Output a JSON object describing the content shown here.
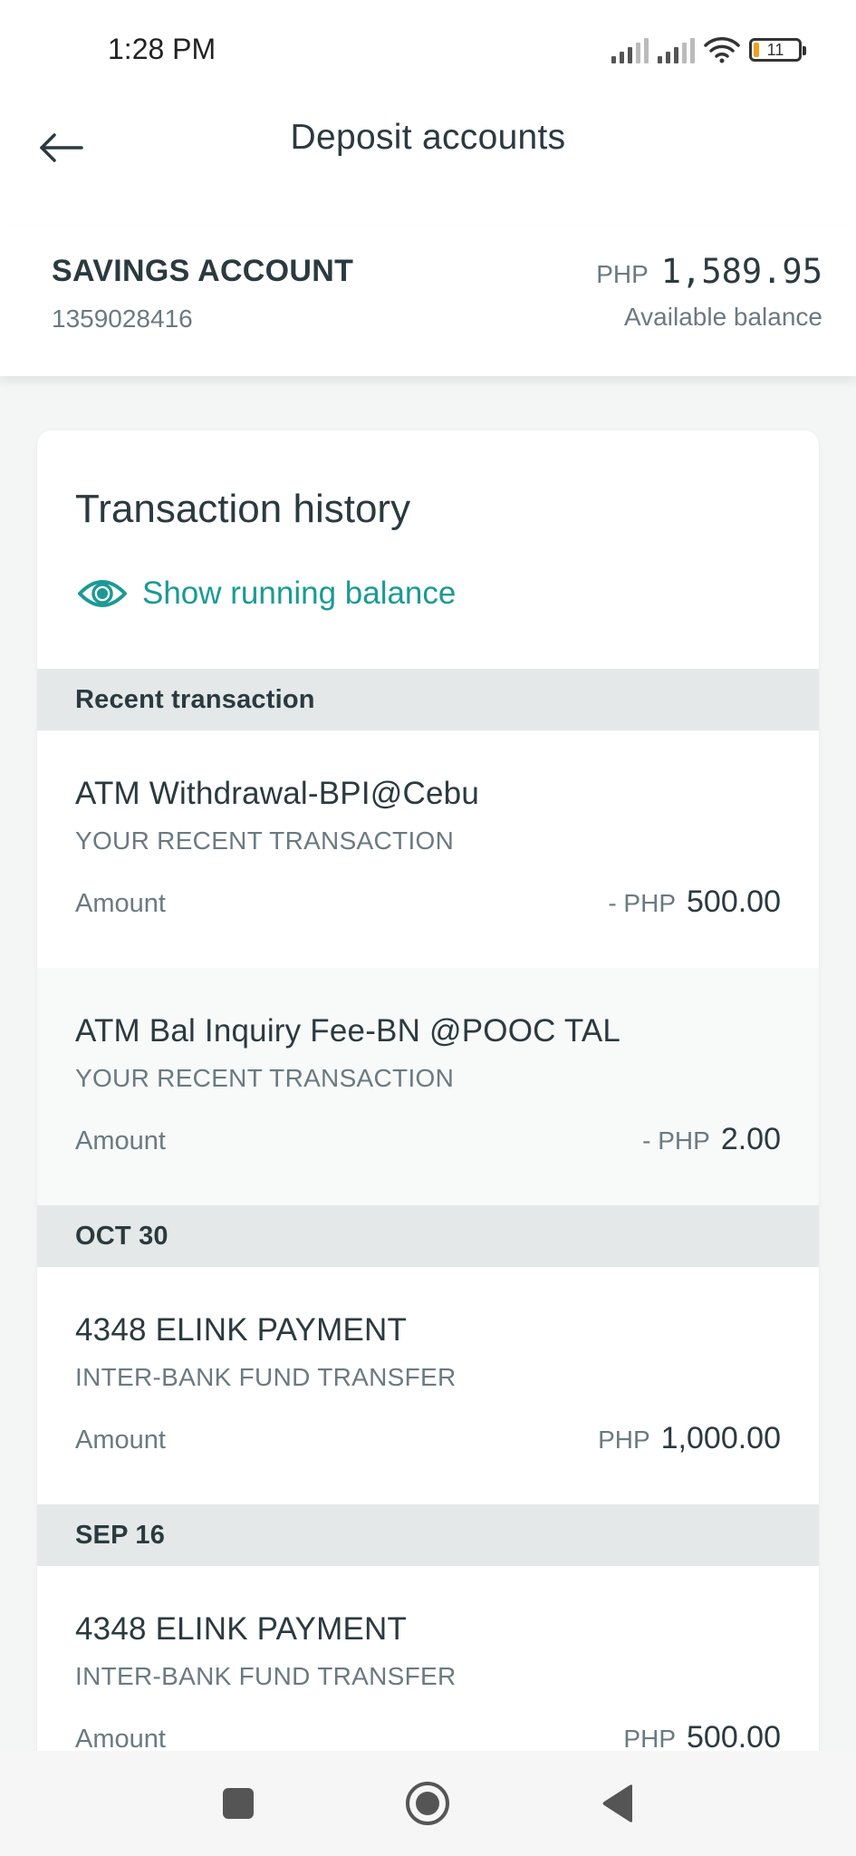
{
  "status": {
    "time": "1:28 PM",
    "battery_level": "11"
  },
  "header": {
    "title": "Deposit accounts",
    "back_icon": "arrow-left-icon"
  },
  "account": {
    "name": "SAVINGS ACCOUNT",
    "number": "1359028416",
    "currency": "PHP",
    "balance": "1,589.95",
    "balance_label": "Available balance"
  },
  "history": {
    "title": "Transaction history",
    "running_balance_label": "Show running balance",
    "sections": [
      {
        "label": "Recent transaction",
        "transactions": [
          {
            "title": "ATM Withdrawal-BPI@Cebu",
            "subtitle": "YOUR RECENT TRANSACTION",
            "amount_label": "Amount",
            "sign_currency": "- PHP",
            "amount": "500.00"
          },
          {
            "title": "ATM Bal Inquiry Fee-BN @POOC TAL",
            "subtitle": "YOUR RECENT TRANSACTION",
            "amount_label": "Amount",
            "sign_currency": "- PHP",
            "amount": "2.00"
          }
        ]
      },
      {
        "label": "OCT 30",
        "transactions": [
          {
            "title": "4348 ELINK PAYMENT",
            "subtitle": "INTER-BANK FUND TRANSFER",
            "amount_label": "Amount",
            "sign_currency": "PHP",
            "amount": "1,000.00"
          }
        ]
      },
      {
        "label": "SEP 16",
        "transactions": [
          {
            "title": "4348 ELINK PAYMENT",
            "subtitle": "INTER-BANK FUND TRANSFER",
            "amount_label": "Amount",
            "sign_currency": "PHP",
            "amount": "500.00"
          }
        ]
      }
    ]
  },
  "colors": {
    "accent": "#1b9a94",
    "section_bg": "#e4e8e8",
    "text_primary": "#2b3a3f",
    "text_secondary": "#6b7a80"
  }
}
